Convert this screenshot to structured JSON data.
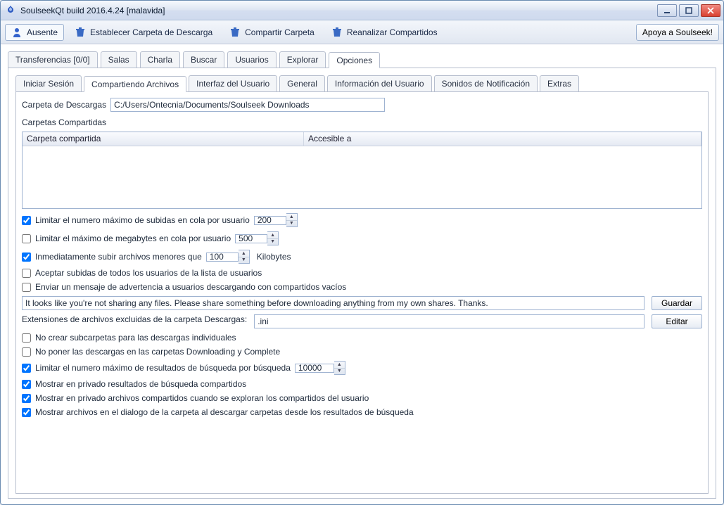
{
  "window": {
    "title": "SoulseekQt build 2016.4.24 [malavida]"
  },
  "toolbar": {
    "away": "Ausente",
    "set_dl_folder": "Establecer Carpeta de Descarga",
    "share_folder": "Compartir Carpeta",
    "rescan": "Reanalizar Compartidos",
    "support": "Apoya a Soulseek!"
  },
  "main_tabs": {
    "items": [
      "Transferencias [0/0]",
      "Salas",
      "Charla",
      "Buscar",
      "Usuarios",
      "Explorar",
      "Opciones"
    ],
    "active": 6
  },
  "options_tabs": {
    "items": [
      "Iniciar Sesión",
      "Compartiendo Archivos",
      "Interfaz del Usuario",
      "General",
      "Información del Usuario",
      "Sonidos de Notificación",
      "Extras"
    ],
    "active": 1
  },
  "sharing": {
    "download_folder_label": "Carpeta de Descargas",
    "download_folder_value": "C:/Users/Ontecnia/Documents/Soulseek Downloads",
    "shared_folders_label": "Carpetas Compartidas",
    "col_folder": "Carpeta compartida",
    "col_access": "Accesible a",
    "limit_uploads_user": {
      "checked": true,
      "label": "Limitar el numero máximo de subidas en cola por usuario",
      "value": "200"
    },
    "limit_mb_user": {
      "checked": false,
      "label": "Limitar el máximo de megabytes en cola por usuario",
      "value": "500"
    },
    "immediate_upload": {
      "checked": true,
      "label": "Inmediatamente subir archivos menores que",
      "value": "100",
      "unit": "Kilobytes"
    },
    "accept_all_users": {
      "checked": false,
      "label": "Aceptar subidas de todos los usuarios de la lista de usuarios"
    },
    "warn_empty": {
      "checked": false,
      "label": "Enviar un mensaje de advertencia a usuarios descargando con compartidos vacíos"
    },
    "warn_message": "It looks like you're not sharing any files. Please share something before downloading anything from my own shares. Thanks.",
    "save_btn": "Guardar",
    "excluded_ext_label": "Extensiones de archivos excluidas de la carpeta Descargas:",
    "excluded_ext_value": ".ini",
    "edit_btn": "Editar",
    "no_subfolders": {
      "checked": false,
      "label": "No crear subcarpetas para las descargas individuales"
    },
    "no_downloading_complete": {
      "checked": false,
      "label": "No poner las descargas en las carpetas Downloading y Complete"
    },
    "limit_search_results": {
      "checked": true,
      "label": "Limitar el numero máximo de resultados de búsqueda por búsqueda",
      "value": "10000"
    },
    "private_search": {
      "checked": true,
      "label": "Mostrar en privado resultados de búsqueda compartidos"
    },
    "private_browse": {
      "checked": true,
      "label": "Mostrar en privado archivos compartidos cuando se exploran los compartidos del usuario"
    },
    "show_files_dialog": {
      "checked": true,
      "label": "Mostrar archivos en el dialogo de la carpeta al descargar carpetas desde los resultados de búsqueda"
    }
  }
}
